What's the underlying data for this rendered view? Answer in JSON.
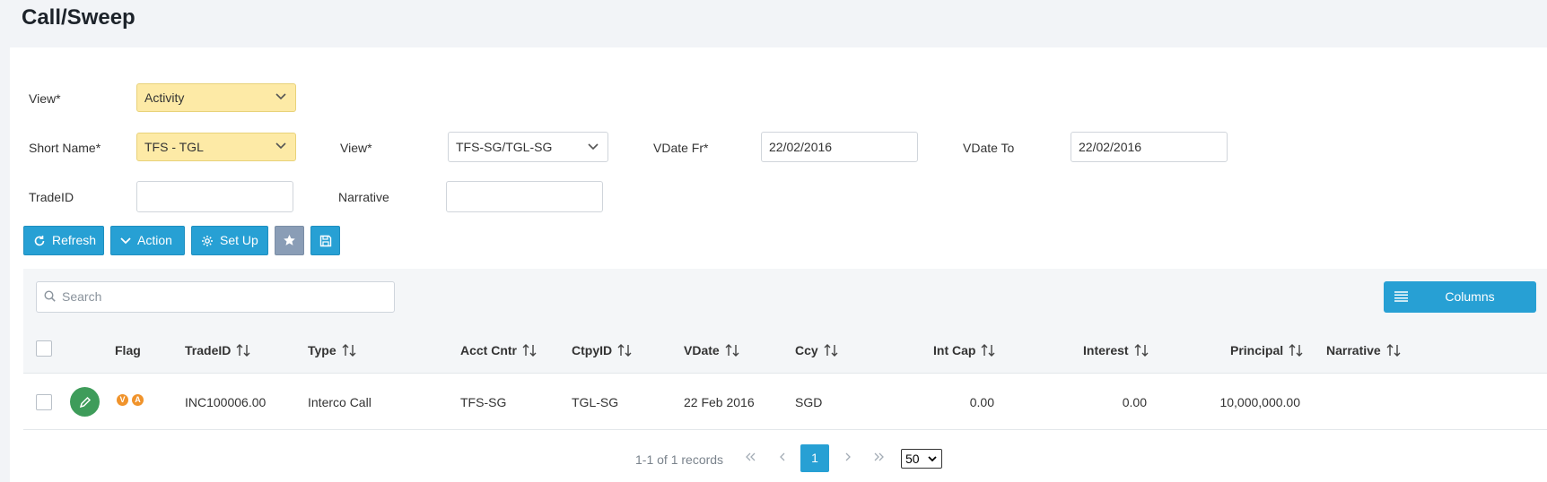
{
  "page": {
    "title": "Call/Sweep"
  },
  "filters": {
    "view_label": "View*",
    "view_value": "Activity",
    "short_name_label": "Short Name*",
    "short_name_value": "TFS - TGL",
    "view2_label": "View*",
    "view2_value": "TFS-SG/TGL-SG",
    "vdate_fr_label": "VDate Fr*",
    "vdate_fr_value": "22/02/2016",
    "vdate_to_label": "VDate To",
    "vdate_to_value": "22/02/2016",
    "tradeid_label": "TradeID",
    "tradeid_value": "",
    "narrative_label": "Narrative",
    "narrative_value": ""
  },
  "toolbar": {
    "refresh_label": "Refresh",
    "action_label": "Action",
    "setup_label": "Set Up"
  },
  "grid": {
    "search_placeholder": "Search",
    "columns_label": "Columns",
    "headers": {
      "flag": "Flag",
      "tradeid": "TradeID",
      "type": "Type",
      "acct_cntr": "Acct Cntr",
      "ctpyid": "CtpyID",
      "vdate": "VDate",
      "ccy": "Ccy",
      "int_cap": "Int Cap",
      "interest": "Interest",
      "principal": "Principal",
      "narrative": "Narrative"
    },
    "rows": [
      {
        "flags": [
          "V",
          "A"
        ],
        "tradeid": "INC100006.00",
        "type": "Interco Call",
        "acct_cntr": "TFS-SG",
        "ctpyid": "TGL-SG",
        "vdate": "22 Feb 2016",
        "ccy": "SGD",
        "int_cap": "0.00",
        "interest": "0.00",
        "principal": "10,000,000.00",
        "narrative": ""
      }
    ]
  },
  "pagination": {
    "summary": "1-1 of 1 records",
    "current_page": "1",
    "page_size": "50"
  },
  "colors": {
    "primary": "#27a0d4",
    "required_field": "#fdeaa6",
    "edit_button": "#3e9c5a",
    "flag": "#f0932b"
  }
}
